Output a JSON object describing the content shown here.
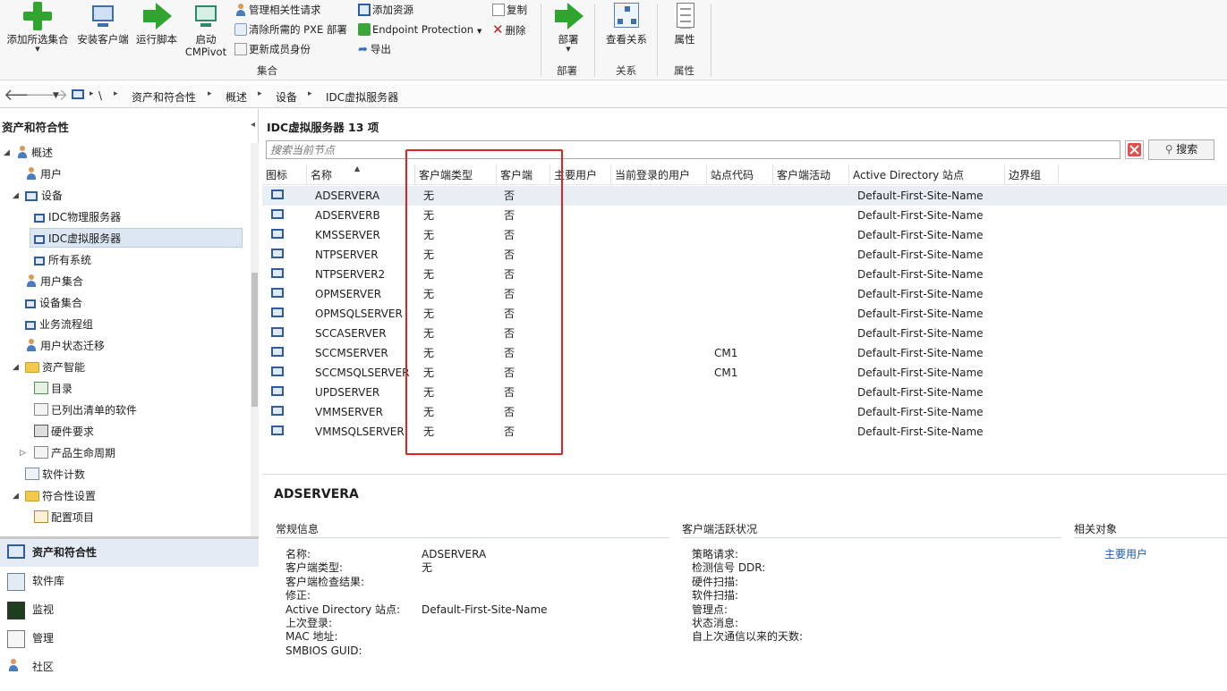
{
  "ribbon": {
    "buttons": {
      "add_to_collection": "添加所选集合",
      "install_client": "安装客户端",
      "run_script": "运行脚本",
      "start_cmpivot_line1": "启动",
      "start_cmpivot_line2": "CMPivot",
      "deploy": "部署",
      "view_relationships": "查看关系",
      "properties": "属性"
    },
    "small_buttons": {
      "manage_affinity": "管理相关性请求",
      "clear_pxe": "清除所需的 PXE 部署",
      "refresh_membership": "更新成员身份",
      "add_resource": "添加资源",
      "endpoint_protection": "Endpoint Protection",
      "export": "导出",
      "copy": "复制",
      "delete": "删除"
    },
    "groups": {
      "collection": "集合",
      "deployment": "部署",
      "relationships": "关系",
      "properties": "属性"
    }
  },
  "breadcrumb": {
    "root": "\\",
    "items": [
      "资产和符合性",
      "概述",
      "设备",
      "IDC虚拟服务器"
    ]
  },
  "left": {
    "title": "资产和符合性",
    "tree": [
      "概述",
      "用户",
      "设备",
      "IDC物理服务器",
      "IDC虚拟服务器",
      "所有系统",
      "用户集合",
      "设备集合",
      "业务流程组",
      "用户状态迁移",
      "资产智能",
      "目录",
      "已列出清单的软件",
      "硬件要求",
      "产品生命周期",
      "软件计数",
      "符合性设置",
      "配置项目"
    ],
    "workspaces": [
      "资产和符合性",
      "软件库",
      "监视",
      "管理",
      "社区"
    ]
  },
  "main": {
    "title": "IDC虚拟服务器 13 项",
    "search": {
      "placeholder": "搜索当前节点",
      "button": "搜索"
    },
    "columns": [
      "图标",
      "名称",
      "客户端类型",
      "客户端",
      "主要用户",
      "当前登录的用户",
      "站点代码",
      "客户端活动",
      "Active Directory 站点",
      "边界组"
    ],
    "rows": [
      {
        "name": "ADSERVERA",
        "client_type": "无",
        "client": "否",
        "site_code": "",
        "ad_site": "Default-First-Site-Name"
      },
      {
        "name": "ADSERVERB",
        "client_type": "无",
        "client": "否",
        "site_code": "",
        "ad_site": "Default-First-Site-Name"
      },
      {
        "name": "KMSSERVER",
        "client_type": "无",
        "client": "否",
        "site_code": "",
        "ad_site": "Default-First-Site-Name"
      },
      {
        "name": "NTPSERVER",
        "client_type": "无",
        "client": "否",
        "site_code": "",
        "ad_site": "Default-First-Site-Name"
      },
      {
        "name": "NTPSERVER2",
        "client_type": "无",
        "client": "否",
        "site_code": "",
        "ad_site": "Default-First-Site-Name"
      },
      {
        "name": "OPMSERVER",
        "client_type": "无",
        "client": "否",
        "site_code": "",
        "ad_site": "Default-First-Site-Name"
      },
      {
        "name": "OPMSQLSERVER",
        "client_type": "无",
        "client": "否",
        "site_code": "",
        "ad_site": "Default-First-Site-Name"
      },
      {
        "name": "SCCASERVER",
        "client_type": "无",
        "client": "否",
        "site_code": "",
        "ad_site": "Default-First-Site-Name"
      },
      {
        "name": "SCCMSERVER",
        "client_type": "无",
        "client": "否",
        "site_code": "CM1",
        "ad_site": "Default-First-Site-Name"
      },
      {
        "name": "SCCMSQLSERVER",
        "client_type": "无",
        "client": "否",
        "site_code": "CM1",
        "ad_site": "Default-First-Site-Name"
      },
      {
        "name": "UPDSERVER",
        "client_type": "无",
        "client": "否",
        "site_code": "",
        "ad_site": "Default-First-Site-Name"
      },
      {
        "name": "VMMSERVER",
        "client_type": "无",
        "client": "否",
        "site_code": "",
        "ad_site": "Default-First-Site-Name"
      },
      {
        "name": "VMMSQLSERVER",
        "client_type": "无",
        "client": "否",
        "site_code": "",
        "ad_site": "Default-First-Site-Name"
      }
    ]
  },
  "details": {
    "title": "ADSERVERA",
    "general": {
      "header": "常规信息",
      "labels": [
        "名称:",
        "客户端类型:",
        "客户端检查结果:",
        "修正:",
        "Active Directory 站点:",
        "上次登录:",
        "MAC 地址:",
        "SMBIOS GUID:"
      ],
      "values": [
        "ADSERVERA",
        "无",
        "",
        "",
        "Default-First-Site-Name",
        "",
        "",
        ""
      ]
    },
    "activity": {
      "header": "客户端活跃状况",
      "labels": [
        "策略请求:",
        "检测信号 DDR:",
        "硬件扫描:",
        "软件扫描:",
        "管理点:",
        "状态消息:",
        "自上次通信以来的天数:"
      ]
    },
    "related": {
      "header": "相关对象",
      "primary_user_link": "主要用户"
    }
  },
  "colors": {
    "accent_red": "#e02424",
    "link": "#1a5aa8",
    "green": "#2fa52f"
  }
}
